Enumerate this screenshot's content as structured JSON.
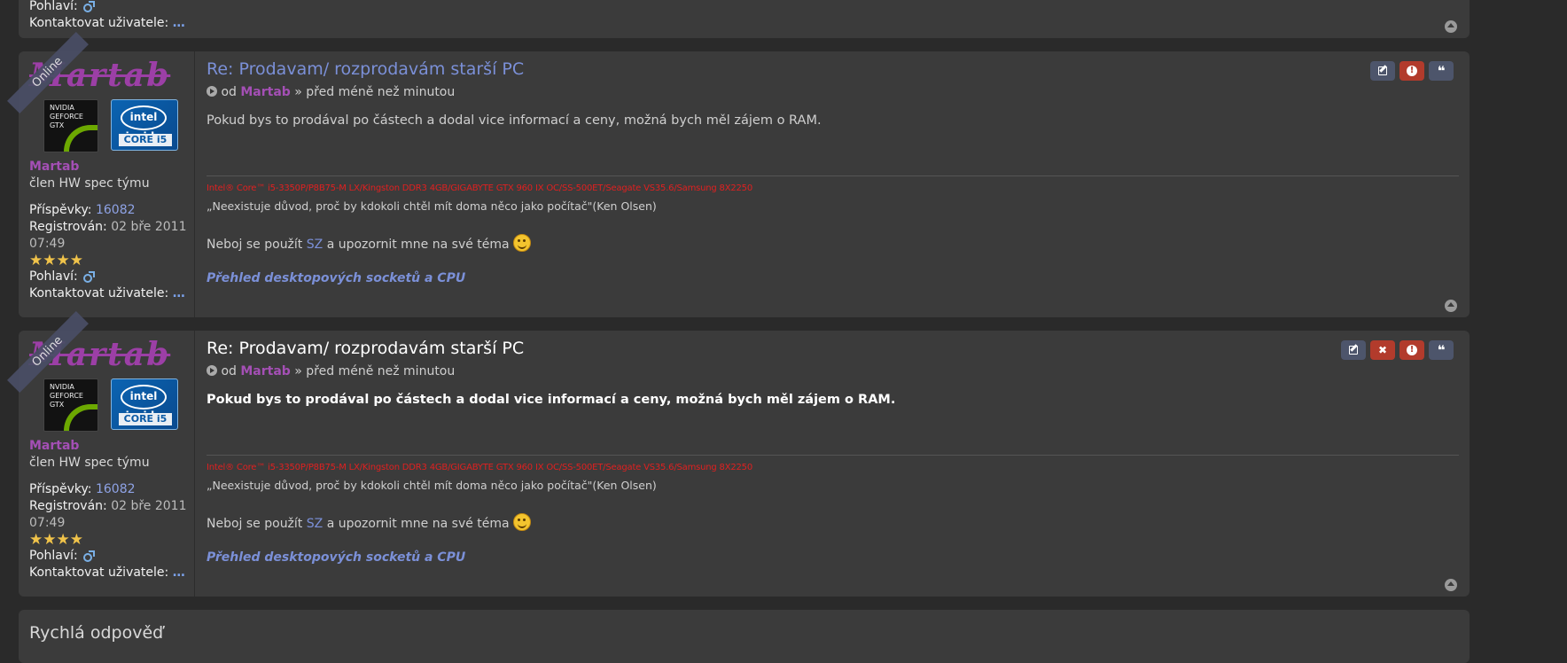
{
  "top_post": {
    "gender_label": "Pohlaví:",
    "contact_label": "Kontaktovat uživatele:",
    "contact_dots": "…"
  },
  "posts": [
    {
      "online": "Online",
      "rank_logo_text": "Martab",
      "gtx_text": "NVIDIA GEFORCE GTX",
      "intel_text": "intel inside",
      "intel_core": "CORE i5",
      "username": "Martab",
      "rank": "člen HW spec týmu",
      "posts_label": "Příspěvky:",
      "posts_count": "16082",
      "registered_label": "Registrován:",
      "registered_value": "02 bře 2011 07:49",
      "stars": "★★★★",
      "gender_label": "Pohlaví:",
      "contact_label": "Kontaktovat uživatele:",
      "contact_dots": "…",
      "title": "Re: Prodavam/ rozprodavám starší PC",
      "by": "od",
      "author": "Martab",
      "time": "» před méně než minutou",
      "content": "Pokud bys to prodával po částech a dodal vice informací a ceny, možná bych měl zájem o RAM.",
      "sig_hw": "Intel® Core™ i5-3350P/P8B75-M LX/Kingston DDR3 4GB/GIGABYTE GTX 960 IX OC/SS-500ET/Seagate VS35.6/Samsung 8X2250",
      "sig_quote": "„Neexistuje důvod, proč by kdokoli chtěl mít doma něco jako počítač\"(Ken Olsen)",
      "sig_line_pre": "Neboj se použít",
      "sig_line_link": "SZ",
      "sig_line_post": "a upozornit mne na své téma",
      "sig_link2": "Přehled desktopových socketů a CPU"
    },
    {
      "online": "Online",
      "rank_logo_text": "Martab",
      "gtx_text": "NVIDIA GEFORCE GTX",
      "intel_text": "intel inside",
      "intel_core": "CORE i5",
      "username": "Martab",
      "rank": "člen HW spec týmu",
      "posts_label": "Příspěvky:",
      "posts_count": "16082",
      "registered_label": "Registrován:",
      "registered_value": "02 bře 2011 07:49",
      "stars": "★★★★",
      "gender_label": "Pohlaví:",
      "contact_label": "Kontaktovat uživatele:",
      "contact_dots": "…",
      "title": "Re: Prodavam/ rozprodavám starší PC",
      "by": "od",
      "author": "Martab",
      "time": "» před méně než minutou",
      "content": "Pokud bys to prodával po částech a dodal vice informací a ceny, možná bych měl zájem o RAM.",
      "sig_hw": "Intel® Core™ i5-3350P/P8B75-M LX/Kingston DDR3 4GB/GIGABYTE GTX 960 IX OC/SS-500ET/Seagate VS35.6/Samsung 8X2250",
      "sig_quote": "„Neexistuje důvod, proč by kdokoli chtěl mít doma něco jako počítač\"(Ken Olsen)",
      "sig_line_pre": "Neboj se použít",
      "sig_line_link": "SZ",
      "sig_line_post": "a upozornit mne na své téma",
      "sig_link2": "Přehled desktopových socketů a CPU"
    }
  ],
  "quick_reply": {
    "title": "Rychlá odpověď"
  },
  "colors": {
    "accent_link": "#7b90d8",
    "username": "#a44fb5",
    "danger": "#b23b2c",
    "signature_red": "#e02020"
  }
}
